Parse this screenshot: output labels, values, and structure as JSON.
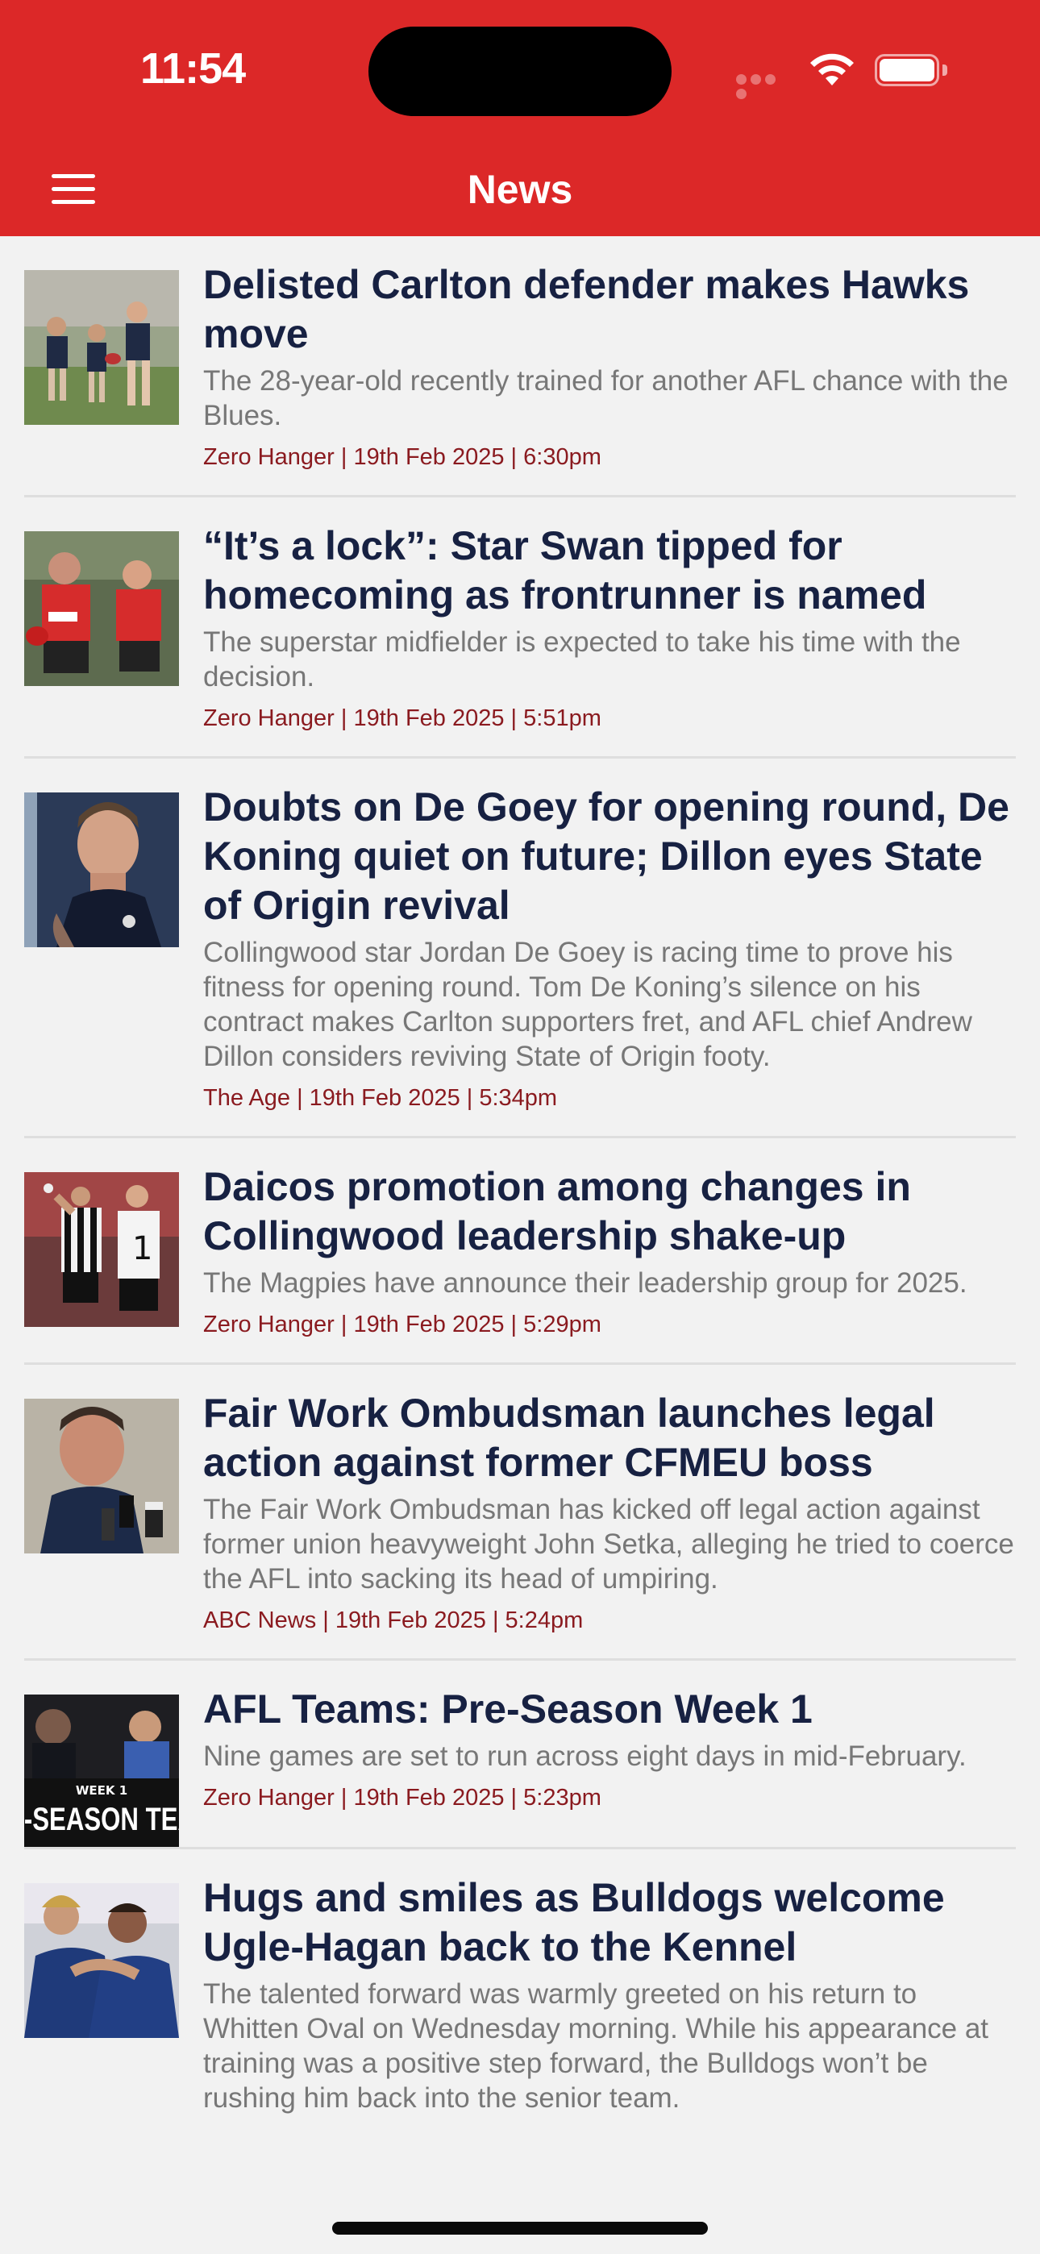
{
  "status_bar": {
    "time": "11:54"
  },
  "nav": {
    "title": "News",
    "menu_icon": "hamburger-menu-icon"
  },
  "colors": {
    "header_bg": "#dc2828",
    "headline": "#172142",
    "summary": "#777777",
    "byline": "#8a1a1f",
    "page_bg": "#f2f2f2"
  },
  "articles": [
    {
      "headline": "Delisted Carlton defender makes Hawks move",
      "summary": "The 28-year-old recently trained for another AFL chance with the Blues.",
      "byline": "Zero Hanger | 19th Feb 2025 | 6:30pm",
      "thumb": "carlton-training-photo"
    },
    {
      "headline": "“It’s a lock”: Star Swan tipped for homecoming as frontrunner is named",
      "summary": "The superstar midfielder is expected to take his time with the decision.",
      "byline": "Zero Hanger | 19th Feb 2025 | 5:51pm",
      "thumb": "swans-players-photo"
    },
    {
      "headline": "Doubts on De Goey for opening round, De Koning quiet on future; Dillon eyes State of Origin revival",
      "summary": "Collingwood star Jordan De Goey is racing time to prove his fitness for opening round. Tom De Koning’s silence on his contract makes Carlton supporters fret, and AFL chief Andrew Dillon considers reviving State of Origin footy.",
      "byline": "The Age | 19th Feb 2025 | 5:34pm",
      "thumb": "de-goey-portrait-photo"
    },
    {
      "headline": "Daicos promotion among changes in Collingwood leadership shake-up",
      "summary": "The Magpies have announce their leadership group for 2025.",
      "byline": "Zero Hanger | 19th Feb 2025 | 5:29pm",
      "thumb": "magpies-celebration-photo"
    },
    {
      "headline": "Fair Work Ombudsman launches legal action against former CFMEU boss",
      "summary": "The Fair Work Ombudsman has kicked off legal action against former union heavyweight John Setka, alleging he tried to coerce the AFL into sacking its head of umpiring.",
      "byline": "ABC News | 19th Feb 2025 | 5:24pm",
      "thumb": "press-conference-photo"
    },
    {
      "headline": "AFL Teams: Pre-Season Week 1",
      "summary": "Nine games are set to run across eight days in mid-February.",
      "byline": "Zero Hanger | 19th Feb 2025 | 5:23pm",
      "thumb": "pre-season-graphic",
      "thumb_text_small": "WEEK 1",
      "thumb_text_big": "E-SEASON TEA"
    },
    {
      "headline": "Hugs and smiles as Bulldogs welcome Ugle-Hagan back to the Kennel",
      "summary": "The talented forward was warmly greeted on his return to Whitten Oval on Wednesday morning. While his appearance at training was a positive step forward, the Bulldogs won’t be rushing him back into the senior team.",
      "byline": "",
      "thumb": "bulldogs-hug-photo"
    }
  ]
}
